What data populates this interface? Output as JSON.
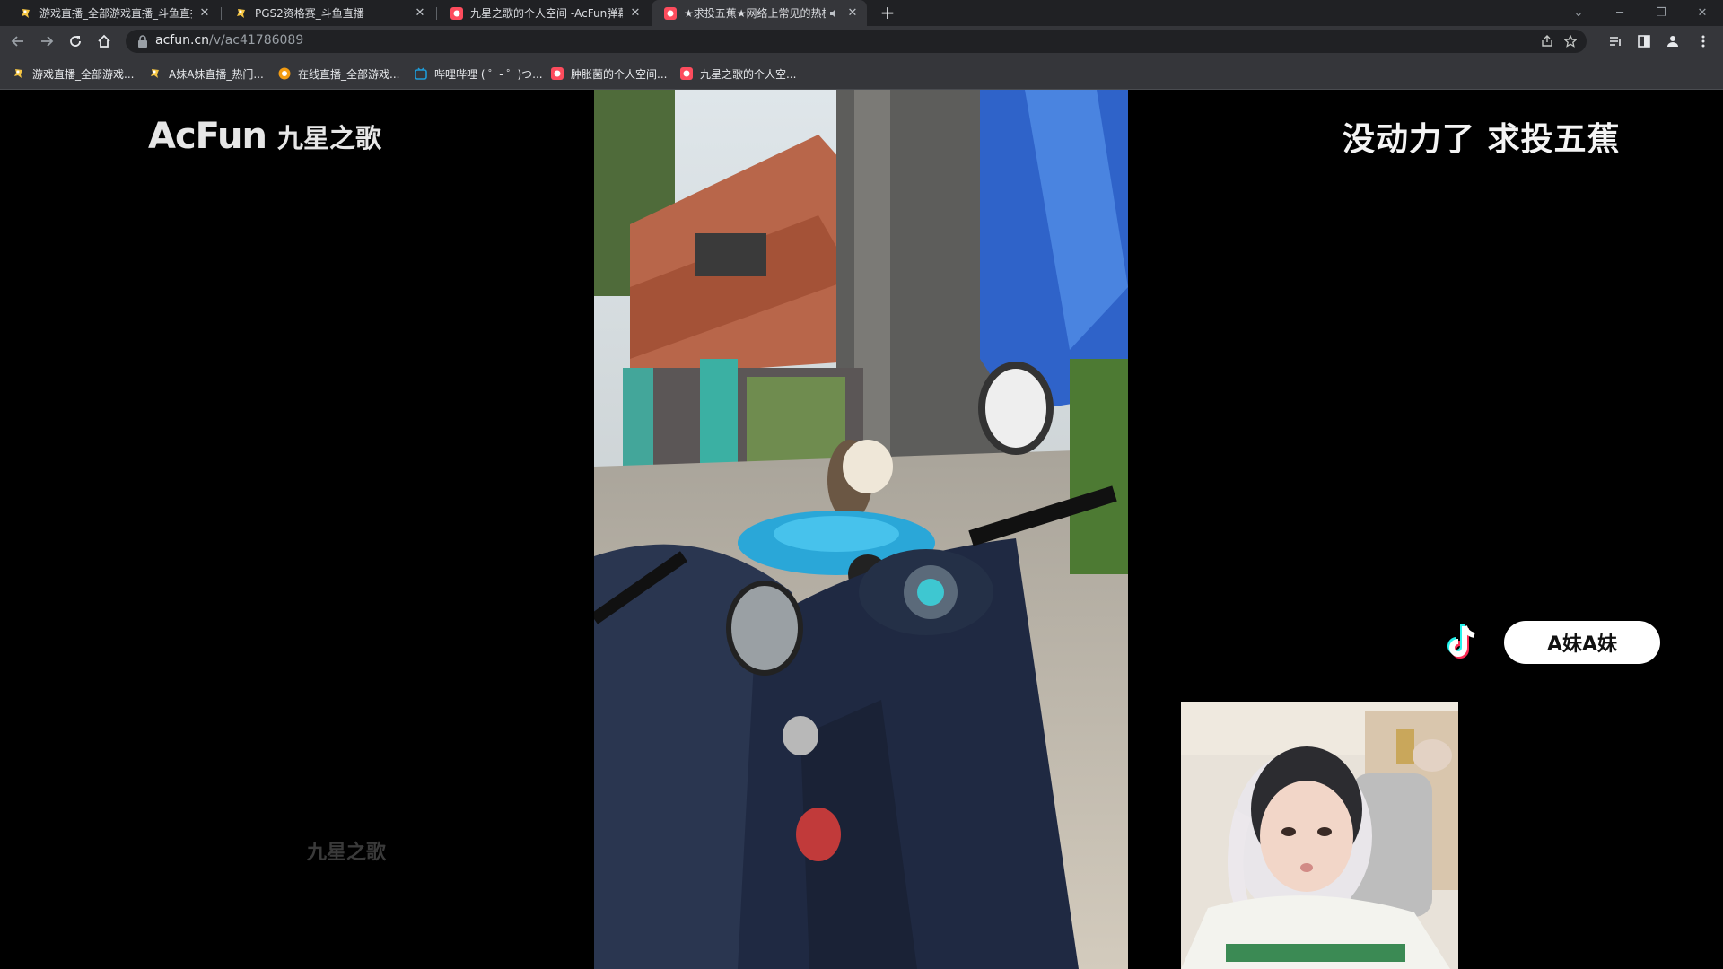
{
  "tabs": [
    {
      "title": "游戏直播_全部游戏直播_斗鱼直播",
      "close": "✕"
    },
    {
      "title": "PGS2资格赛_斗鱼直播",
      "close": "✕"
    },
    {
      "title": "九星之歌的个人空间 -AcFun弹幕视频网",
      "close": "✕"
    },
    {
      "title": "★求投五蕉★网络上常见的热梗",
      "close": "✕",
      "active": true
    }
  ],
  "tab_bar": {
    "new_tab": "+",
    "minimize": "─",
    "restore": "❐",
    "close": "✕",
    "tab_search": "⌄"
  },
  "address_bar": {
    "host": "acfun.cn",
    "path": "/v/ac41786089"
  },
  "bookmarks": [
    {
      "label": "游戏直播_全部游戏..."
    },
    {
      "label": "A妹A妹直播_热门..."
    },
    {
      "label": "在线直播_全部游戏..."
    },
    {
      "label": "哔哩哔哩 ( ゜- ゜)つ..."
    },
    {
      "label": "肿胀菌的个人空间..."
    },
    {
      "label": "九星之歌的个人空..."
    }
  ],
  "page": {
    "logo_text": "AcFun",
    "logo_name": "九星之歌",
    "watermark": "九星之歌",
    "caption": "没动力了 求投五蕉",
    "streamer_tag": "A妹A妹"
  },
  "colors": {
    "tab_bar_bg": "#202124",
    "toolbar_bg": "#35363a",
    "page_bg": "#000000",
    "tag_bg": "#ffffff"
  },
  "icons": {
    "back": "arrow-left-icon",
    "forward": "arrow-right-icon",
    "reload": "reload-icon",
    "home": "home-icon",
    "lock": "lock-icon",
    "share": "share-icon",
    "star": "star-icon",
    "media": "media-control-icon",
    "sidepanel": "side-panel-icon",
    "profile": "profile-icon",
    "menu": "kebab-menu-icon",
    "tiktok": "tiktok-icon",
    "mute": "speaker-muted-icon"
  }
}
